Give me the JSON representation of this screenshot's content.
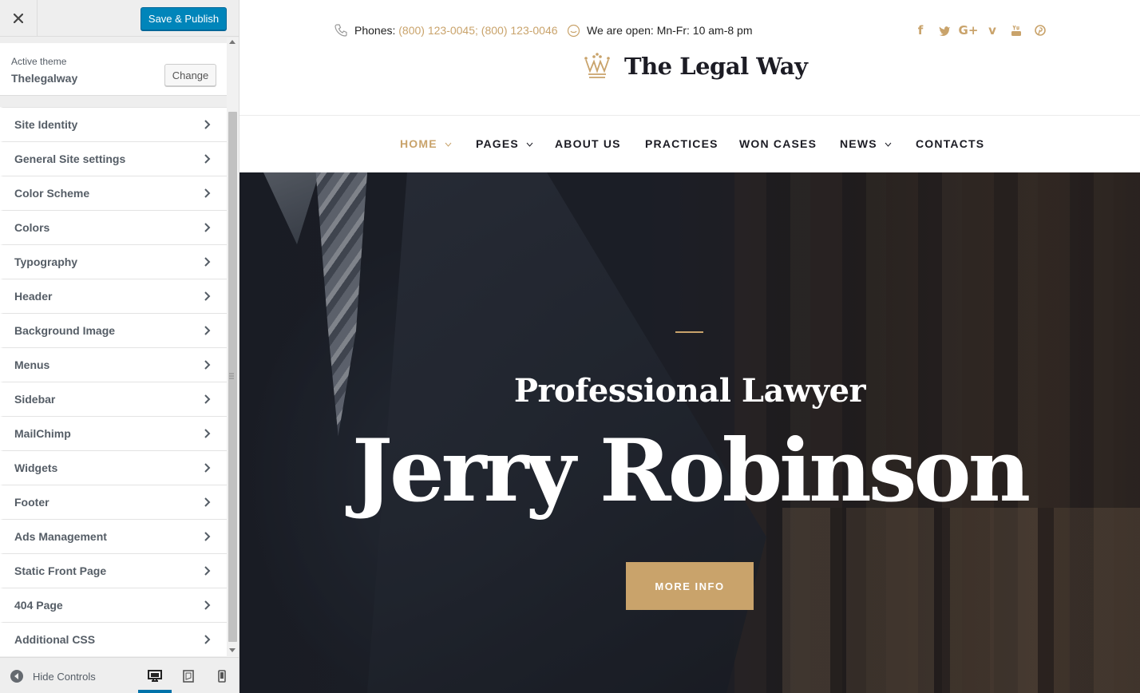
{
  "customizer": {
    "save_label": "Save & Publish",
    "active_theme_caption": "Active theme",
    "active_theme_name": "Thelegalway",
    "change_label": "Change",
    "panels": [
      "Site Identity",
      "General Site settings",
      "Color Scheme",
      "Colors",
      "Typography",
      "Header",
      "Background Image",
      "Menus",
      "Sidebar",
      "MailChimp",
      "Widgets",
      "Footer",
      "Ads Management",
      "Static Front Page",
      "404 Page",
      "Additional CSS"
    ],
    "hide_controls_label": "Hide Controls",
    "accent_color": "#0085ba"
  },
  "site": {
    "phones_label": "Phones:",
    "phone_1": "(800) 123-0045",
    "phone_sep": ";",
    "phone_2": "(800) 123-0046",
    "hours_label": "We are open:",
    "hours_value": "Mn-Fr: 10 am-8 pm",
    "socials": [
      "facebook-icon",
      "twitter-icon",
      "google-plus-icon",
      "vimeo-icon",
      "youtube-icon",
      "pinterest-icon"
    ],
    "logo_text": "The Legal Way",
    "nav": [
      "HOME",
      "PAGES",
      "ABOUT US",
      "PRACTICES",
      "WON CASES",
      "NEWS",
      "CONTACTS"
    ],
    "hero_subtitle": "Professional Lawyer",
    "hero_title": "Jerry Robinson",
    "hero_button": "MORE INFO",
    "gold_color": "#c9a36b"
  }
}
